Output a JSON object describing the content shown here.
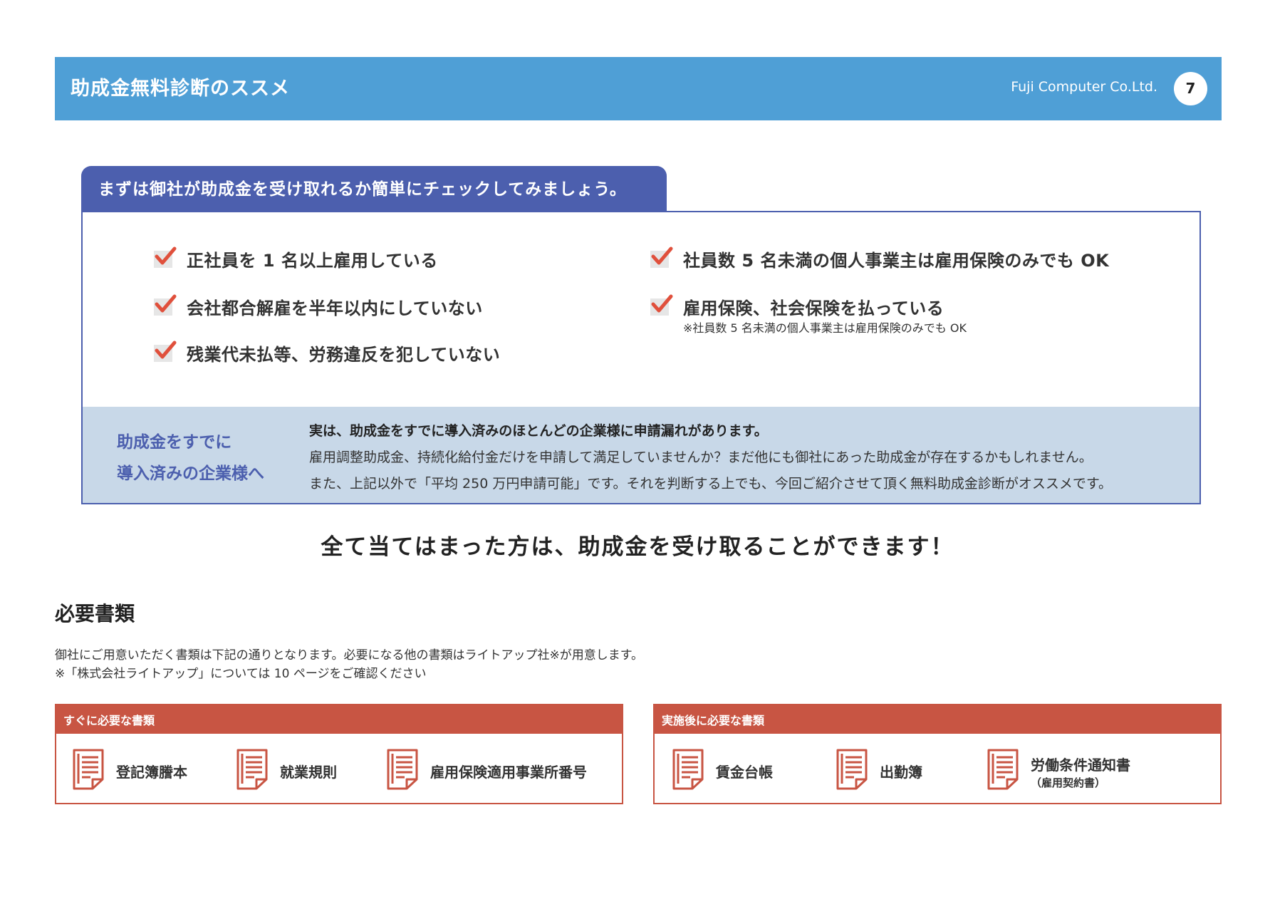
{
  "header": {
    "title": "助成金無料診断のススメ",
    "company": "Fuji Computer Co.Ltd.",
    "page_number": "7"
  },
  "check_section": {
    "tab_title": "まずは御社が助成金を受け取れるか簡単にチェックしてみましょう。",
    "items_left": [
      "正社員を 1 名以上雇用している",
      "会社都合解雇を半年以内にしていない",
      "残業代未払等、労務違反を犯していない"
    ],
    "items_right": [
      "社員数 5 名未満の個人事業主は雇用保険のみでも OK",
      "雇用保険、社会保険を払っている"
    ],
    "right_note": "※社員数 5 名未満の個人事業主は雇用保険のみでも OK",
    "check_color": "#e0503c"
  },
  "info": {
    "heading_line1": "助成金をすでに",
    "heading_line2": "導入済みの企業様へ",
    "line1": "実は、助成金をすでに導入済みのほとんどの企業様に申請漏れがあります。",
    "line2": "雇用調整助成金、持続化給付金だけを申請して満足していませんか？まだ他にも御社にあった助成金が存在するかもしれません。",
    "line3": "また、上記以外で「平均 250 万円申請可能」です。それを判断する上でも、今回ご紹介させて頂く無料助成金診断がオススメです。"
  },
  "statement": "全て当てはまった方は、助成金を受け取ることができます！",
  "docs": {
    "title": "必要書類",
    "desc_line1": "御社にご用意いただく書類は下記の通りとなります。必要になる他の書類はライトアップ社※が用意します。",
    "desc_line2": "※「株式会社ライトアップ」については 10 ページをご確認ください",
    "immediate": {
      "heading": "すぐに必要な書類",
      "items": [
        "登記簿謄本",
        "就業規則",
        "雇用保険適用事業所番号"
      ]
    },
    "after": {
      "heading": "実施後に必要な書類",
      "items": [
        "賃金台帳",
        "出勤簿",
        "労働条件通知書"
      ],
      "item3_sub": "（雇用契約書）"
    },
    "accent_color": "#c85543"
  }
}
